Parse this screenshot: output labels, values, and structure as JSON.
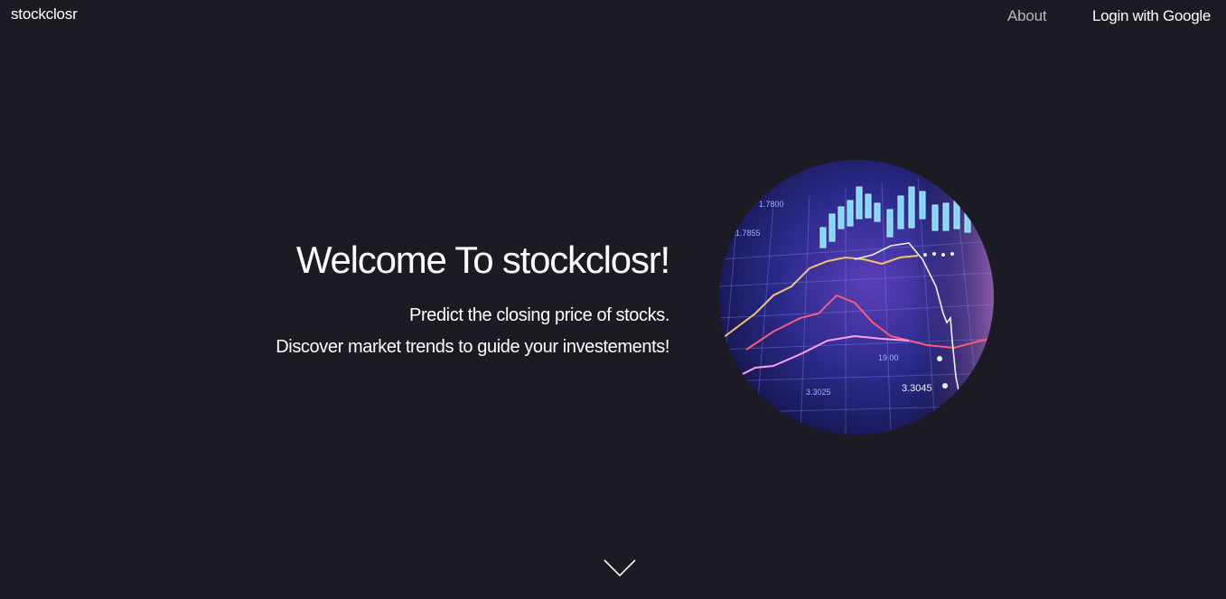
{
  "navbar": {
    "brand": "stockclosr",
    "about_label": "About",
    "login_label": "Login with Google"
  },
  "hero": {
    "title": "Welcome To stockclosr!",
    "line1": "Predict the closing price of stocks.",
    "line2": "Discover market trends to guide your investements!",
    "image_labels": {
      "a": "1.7800",
      "b": "1.7855",
      "c": "19.00",
      "d": "3.3045",
      "e": "3.3025"
    }
  },
  "icons": {
    "scroll": "chevron-down-icon"
  },
  "colors": {
    "background": "#1c1b23",
    "text": "#ffffff",
    "nav_muted": "#b9b8c0"
  }
}
